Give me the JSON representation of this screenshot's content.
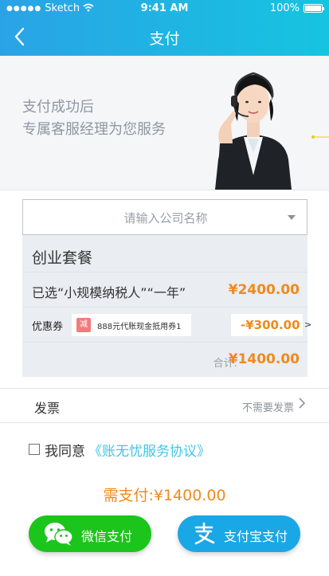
{
  "status_bar": {
    "carrier": "Sketch",
    "time": "9:41 AM",
    "battery": "100%"
  },
  "header": {
    "title": "支付"
  },
  "banner": {
    "line1": "支付成功后",
    "line2": "专属客服经理为您服务"
  },
  "company_select": {
    "placeholder": "请输入公司名称"
  },
  "package": {
    "name": "创业套餐",
    "selected_text": "已选“小规模纳税人”“一年”",
    "price": "¥2400.00",
    "coupon_label": "优惠券",
    "coupon_tag": "减",
    "coupon_text": "888元代账现金抵用券1",
    "discount": "-¥300.00",
    "arrow": ">",
    "total_label": "合计:",
    "total": "¥1400.00"
  },
  "invoice": {
    "label": "发票",
    "value": "不需要发票"
  },
  "agreement": {
    "prefix": "我同意",
    "link": "《账无忧服务协议》"
  },
  "amount": {
    "text": "需支付:¥1400.00"
  },
  "pay_buttons": {
    "wechat": "微信支付",
    "alipay": "支付宝支付"
  },
  "colors": {
    "header_start": "#2aa3e6",
    "header_end": "#16c4e0",
    "accent_orange": "#f08a1c",
    "wechat_green": "#1cc51b",
    "alipay_blue": "#1aa7e6",
    "link_cyan": "#3ec6e8"
  },
  "icons": {
    "back": "chevron-left-icon",
    "wechat": "wechat-icon",
    "alipay": "alipay-icon",
    "dropdown": "caret-down-icon",
    "invoice": "chevron-right-icon"
  }
}
